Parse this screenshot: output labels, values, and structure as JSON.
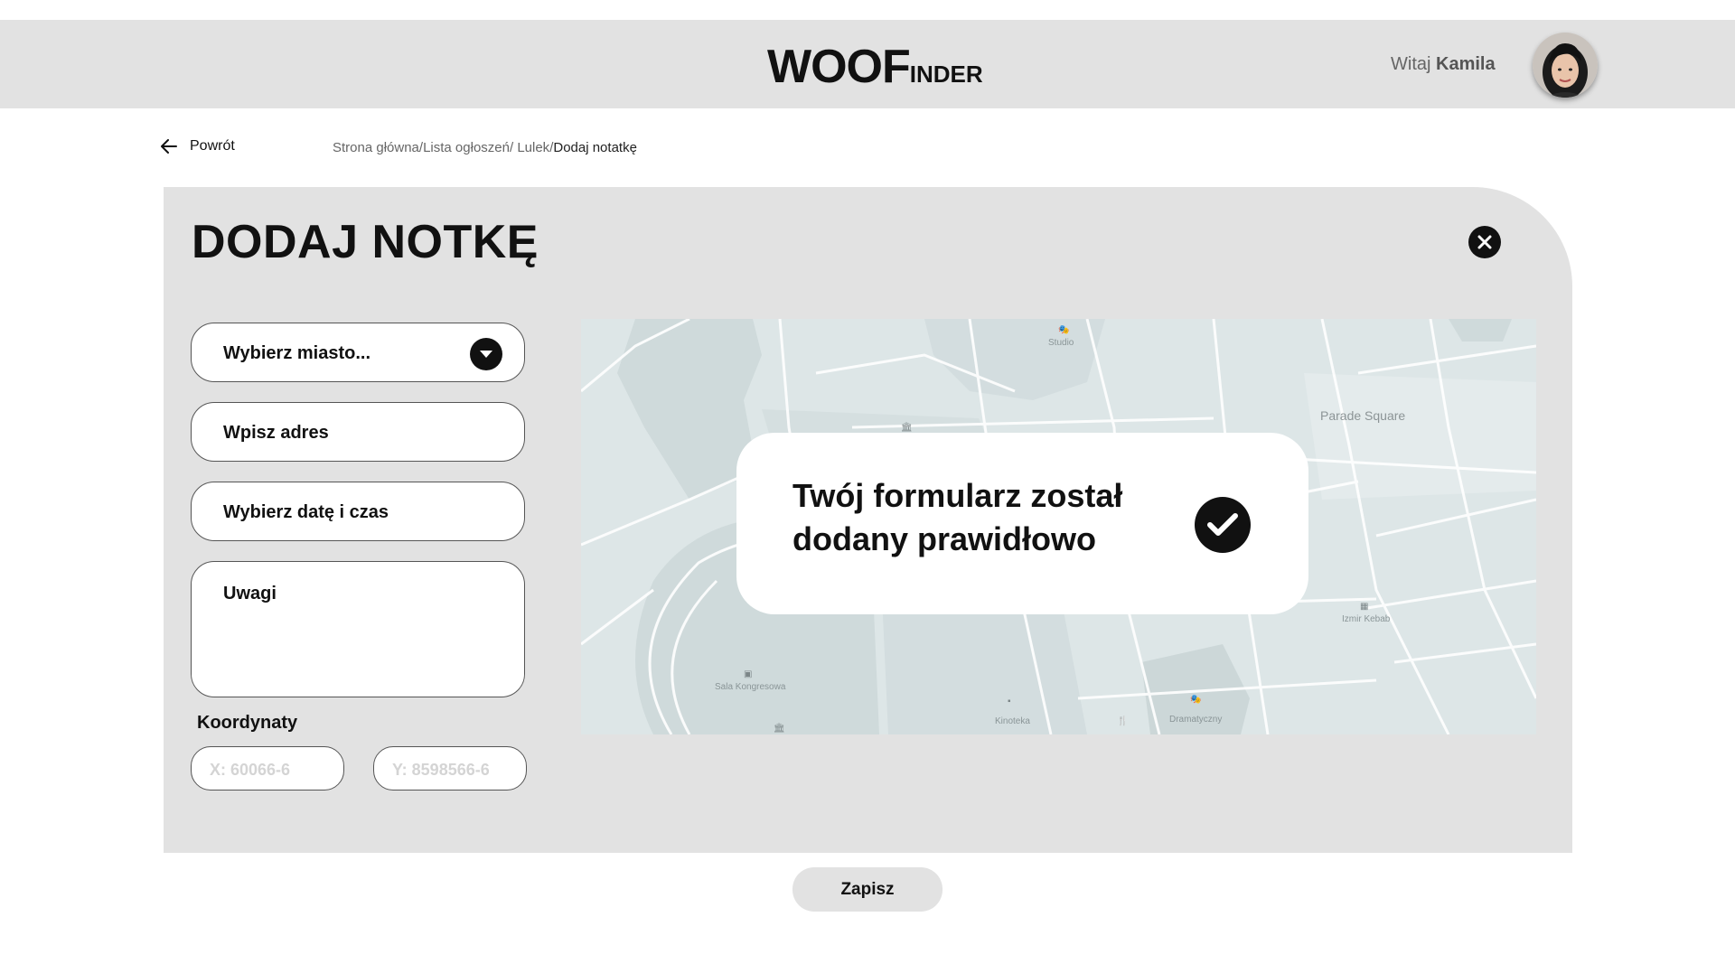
{
  "header": {
    "logo_main": "WOOF",
    "logo_rest": "INDER",
    "greeting_prefix": "Witaj",
    "user_name": "Kamila"
  },
  "nav": {
    "back_label": "Powrót",
    "breadcrumb": [
      "Strona główna",
      "Lista ogłoszeń",
      " Lulek",
      "Dodaj notatkę"
    ]
  },
  "form": {
    "title": "DODAJ NOTKĘ",
    "city_placeholder": "Wybierz miasto...",
    "address_placeholder": "Wpisz adres",
    "datetime_placeholder": "Wybierz datę i czas",
    "notes_placeholder": "Uwagi",
    "coords_label": "Koordynaty",
    "x_placeholder": "X: 60066-6",
    "y_placeholder": "Y: 8598566-6",
    "save_label": "Zapisz"
  },
  "map": {
    "labels": {
      "studio": "Studio",
      "parade_square": "Parade Square",
      "izmir_kebab": "Izmir Kebab",
      "sala_kongresowa": "Sala Kongresowa",
      "kinoteka": "Kinoteka",
      "dramatyczny": "Dramatyczny"
    }
  },
  "toast": {
    "message": "Twój formularz został dodany prawidłowo"
  },
  "colors": {
    "header_bg": "#e2e2e2",
    "card_bg": "#e2e2e2",
    "map_bg": "#dde6e7",
    "accent": "#111111"
  },
  "icons": {
    "back": "arrow-left-icon",
    "close": "close-icon",
    "dropdown": "chevron-down-icon",
    "success": "check-icon"
  }
}
